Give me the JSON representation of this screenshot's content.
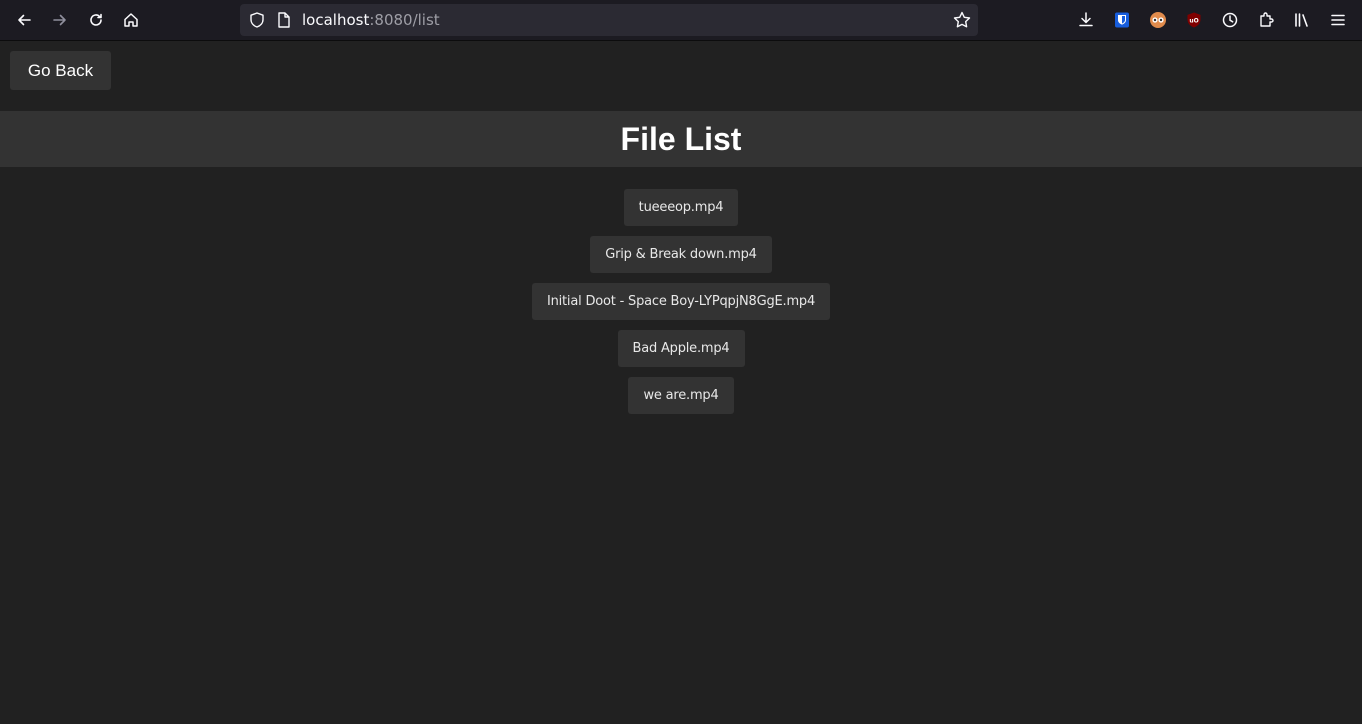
{
  "browser": {
    "url_host": "localhost",
    "url_rest": ":8080/list",
    "icons": [
      "back-icon",
      "forward-icon",
      "reload-icon",
      "home-icon",
      "shield-icon",
      "page-icon",
      "bookmark-star-icon",
      "download-icon",
      "bitwarden-icon",
      "privacy-badger-icon",
      "ublock-icon",
      "history-icon",
      "extensions-icon",
      "library-icon",
      "menu-icon"
    ]
  },
  "page": {
    "go_back_label": "Go Back",
    "title": "File List",
    "files": [
      "tueeeop.mp4",
      "Grip & Break down.mp4",
      "Initial Doot - Space Boy-LYPqpjN8GgE.mp4",
      "Bad Apple.mp4",
      "we are.mp4"
    ]
  },
  "colors": {
    "background": "#212121",
    "button_bg": "#333333",
    "header_bg": "#333333",
    "text": "#ffffff"
  }
}
